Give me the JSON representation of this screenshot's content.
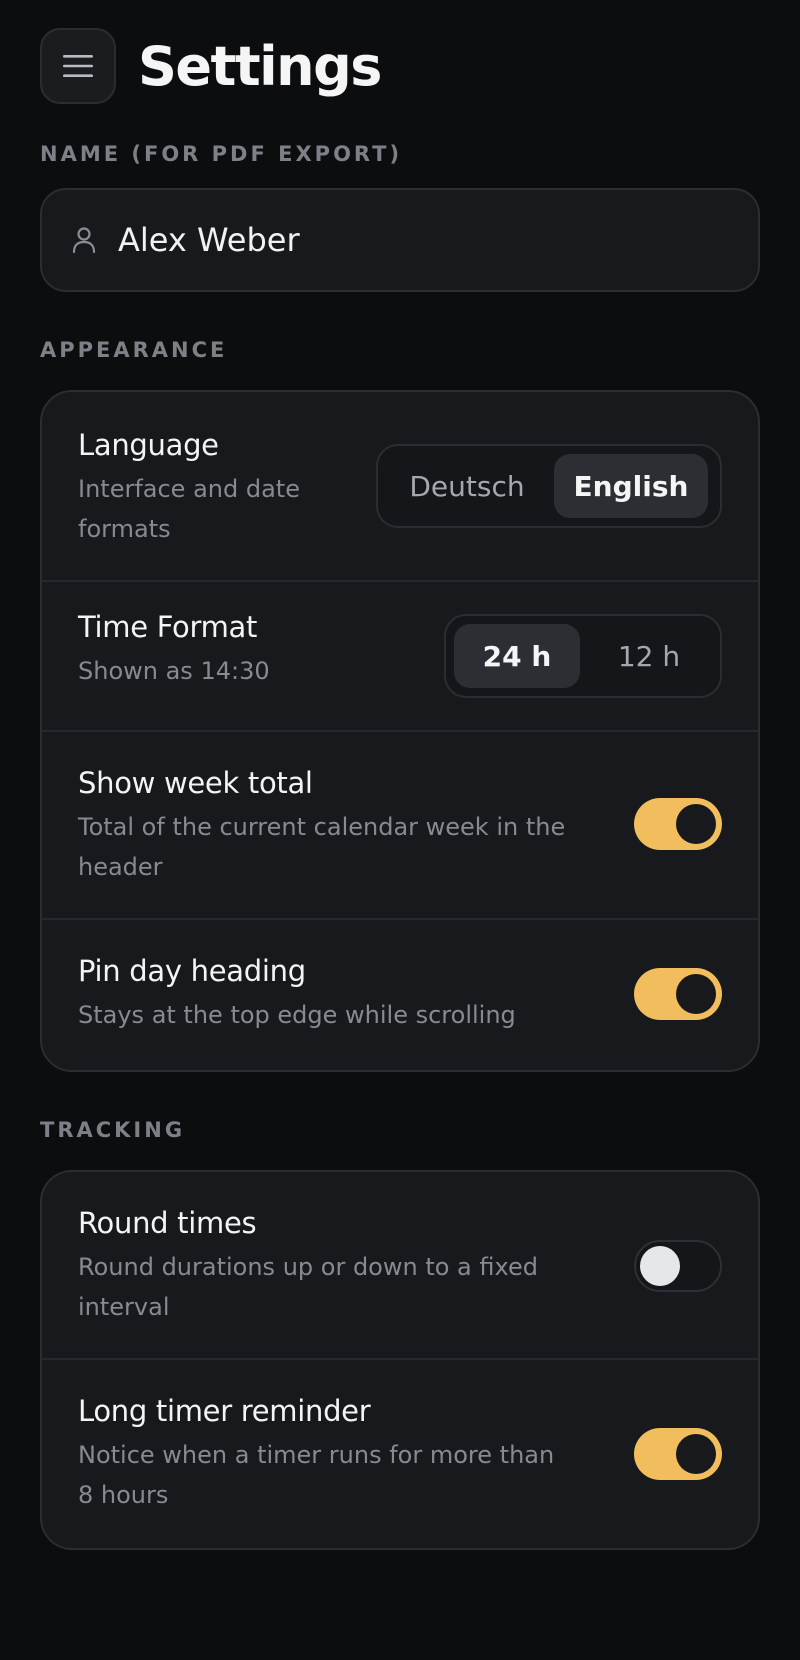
{
  "header": {
    "title": "Settings",
    "menu_icon": "hamburger-menu-icon"
  },
  "name_section": {
    "label": "NAME (FOR PDF EXPORT)",
    "icon": "user-icon",
    "value": "Alex Weber"
  },
  "appearance": {
    "label": "APPEARANCE",
    "language": {
      "title": "Language",
      "description": "Interface and date formats",
      "options": [
        "Deutsch",
        "English"
      ],
      "selected": "English"
    },
    "time_format": {
      "title": "Time Format",
      "description": "Shown as 14:30",
      "options": [
        "24 h",
        "12 h"
      ],
      "selected": "24 h"
    },
    "show_week_total": {
      "title": "Show week total",
      "description": "Total of the current calendar week in the header",
      "enabled": true
    },
    "pin_day_heading": {
      "title": "Pin day heading",
      "description": "Stays at the top edge while scrolling",
      "enabled": true
    }
  },
  "tracking": {
    "label": "TRACKING",
    "round_times": {
      "title": "Round times",
      "description": "Round durations up or down to a fixed interval",
      "enabled": false
    },
    "long_timer_reminder": {
      "title": "Long timer reminder",
      "description": "Notice when a timer runs for more than 8 hours",
      "enabled": true
    }
  },
  "colors": {
    "background": "#0b0d0f",
    "card": "#17191c",
    "accent": "#f2bd5d",
    "muted_text": "#868a91"
  }
}
